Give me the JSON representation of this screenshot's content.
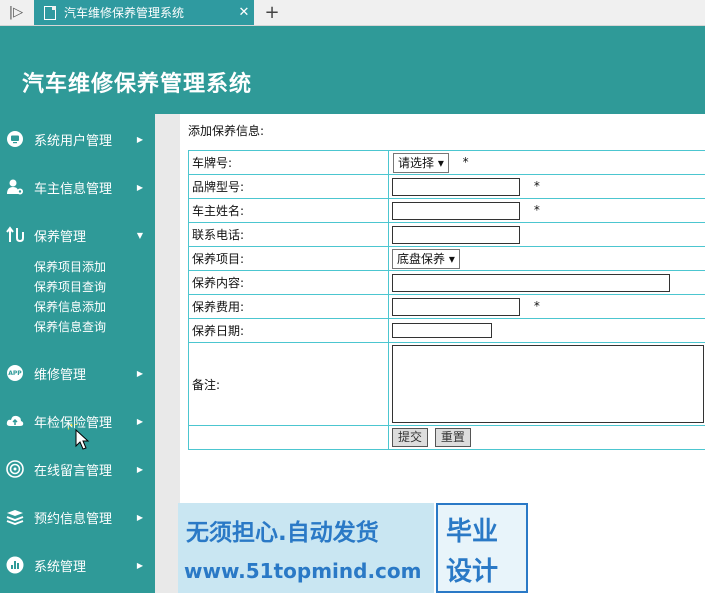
{
  "browser": {
    "tab_title": "汽车维修保养管理系统",
    "close_glyph": "✕",
    "new_tab_glyph": "+",
    "sidebar_glyph": "|▷"
  },
  "header": {
    "title": "汽车维修保养管理系统"
  },
  "sidebar": {
    "items": [
      {
        "label": "系统用户管理",
        "icon": "monitor-icon",
        "arrow": "▶"
      },
      {
        "label": "车主信息管理",
        "icon": "user-gear-icon",
        "arrow": "▶"
      },
      {
        "label": "保养管理",
        "icon": "swap-arrows-icon",
        "arrow": "▼"
      },
      {
        "label": "维修管理",
        "icon": "app-icon",
        "arrow": "▶",
        "icon_text": "APP"
      },
      {
        "label": "年检保险管理",
        "icon": "cloud-upload-icon",
        "arrow": "▶"
      },
      {
        "label": "在线留言管理",
        "icon": "settings-icon",
        "arrow": "▶"
      },
      {
        "label": "预约信息管理",
        "icon": "layers-icon",
        "arrow": "▶"
      },
      {
        "label": "系统管理",
        "icon": "chart-icon",
        "arrow": "▶"
      }
    ],
    "submenu": [
      "保养项目添加",
      "保养项目查询",
      "保养信息添加",
      "保养信息查询"
    ]
  },
  "form": {
    "title": "添加保养信息:",
    "required_mark": "*",
    "fields": [
      {
        "label": "车牌号:",
        "type": "select",
        "value": "请选择 ▾",
        "required": true
      },
      {
        "label": "品牌型号:",
        "type": "text",
        "value": "",
        "required": true
      },
      {
        "label": "车主姓名:",
        "type": "text",
        "value": "",
        "required": true
      },
      {
        "label": "联系电话:",
        "type": "text",
        "value": "",
        "required": false
      },
      {
        "label": "保养项目:",
        "type": "select",
        "value": "底盘保养 ▾",
        "required": false
      },
      {
        "label": "保养内容:",
        "type": "text-wide",
        "value": "",
        "required": false
      },
      {
        "label": "保养费用:",
        "type": "text",
        "value": "",
        "required": true
      },
      {
        "label": "保养日期:",
        "type": "date",
        "value": "",
        "required": false
      },
      {
        "label": "备注:",
        "type": "textarea",
        "value": "",
        "required": false
      }
    ],
    "submit_label": "提交",
    "reset_label": "重置"
  },
  "watermark": {
    "line1": "无须担心.自动发货",
    "line2": "www.51topmind.com",
    "badge_line1": "毕业",
    "badge_line2": "设计"
  },
  "colors": {
    "teal": "#2f9a98",
    "table_border": "#4cc6d0",
    "watermark_blue": "#2a79c6"
  }
}
